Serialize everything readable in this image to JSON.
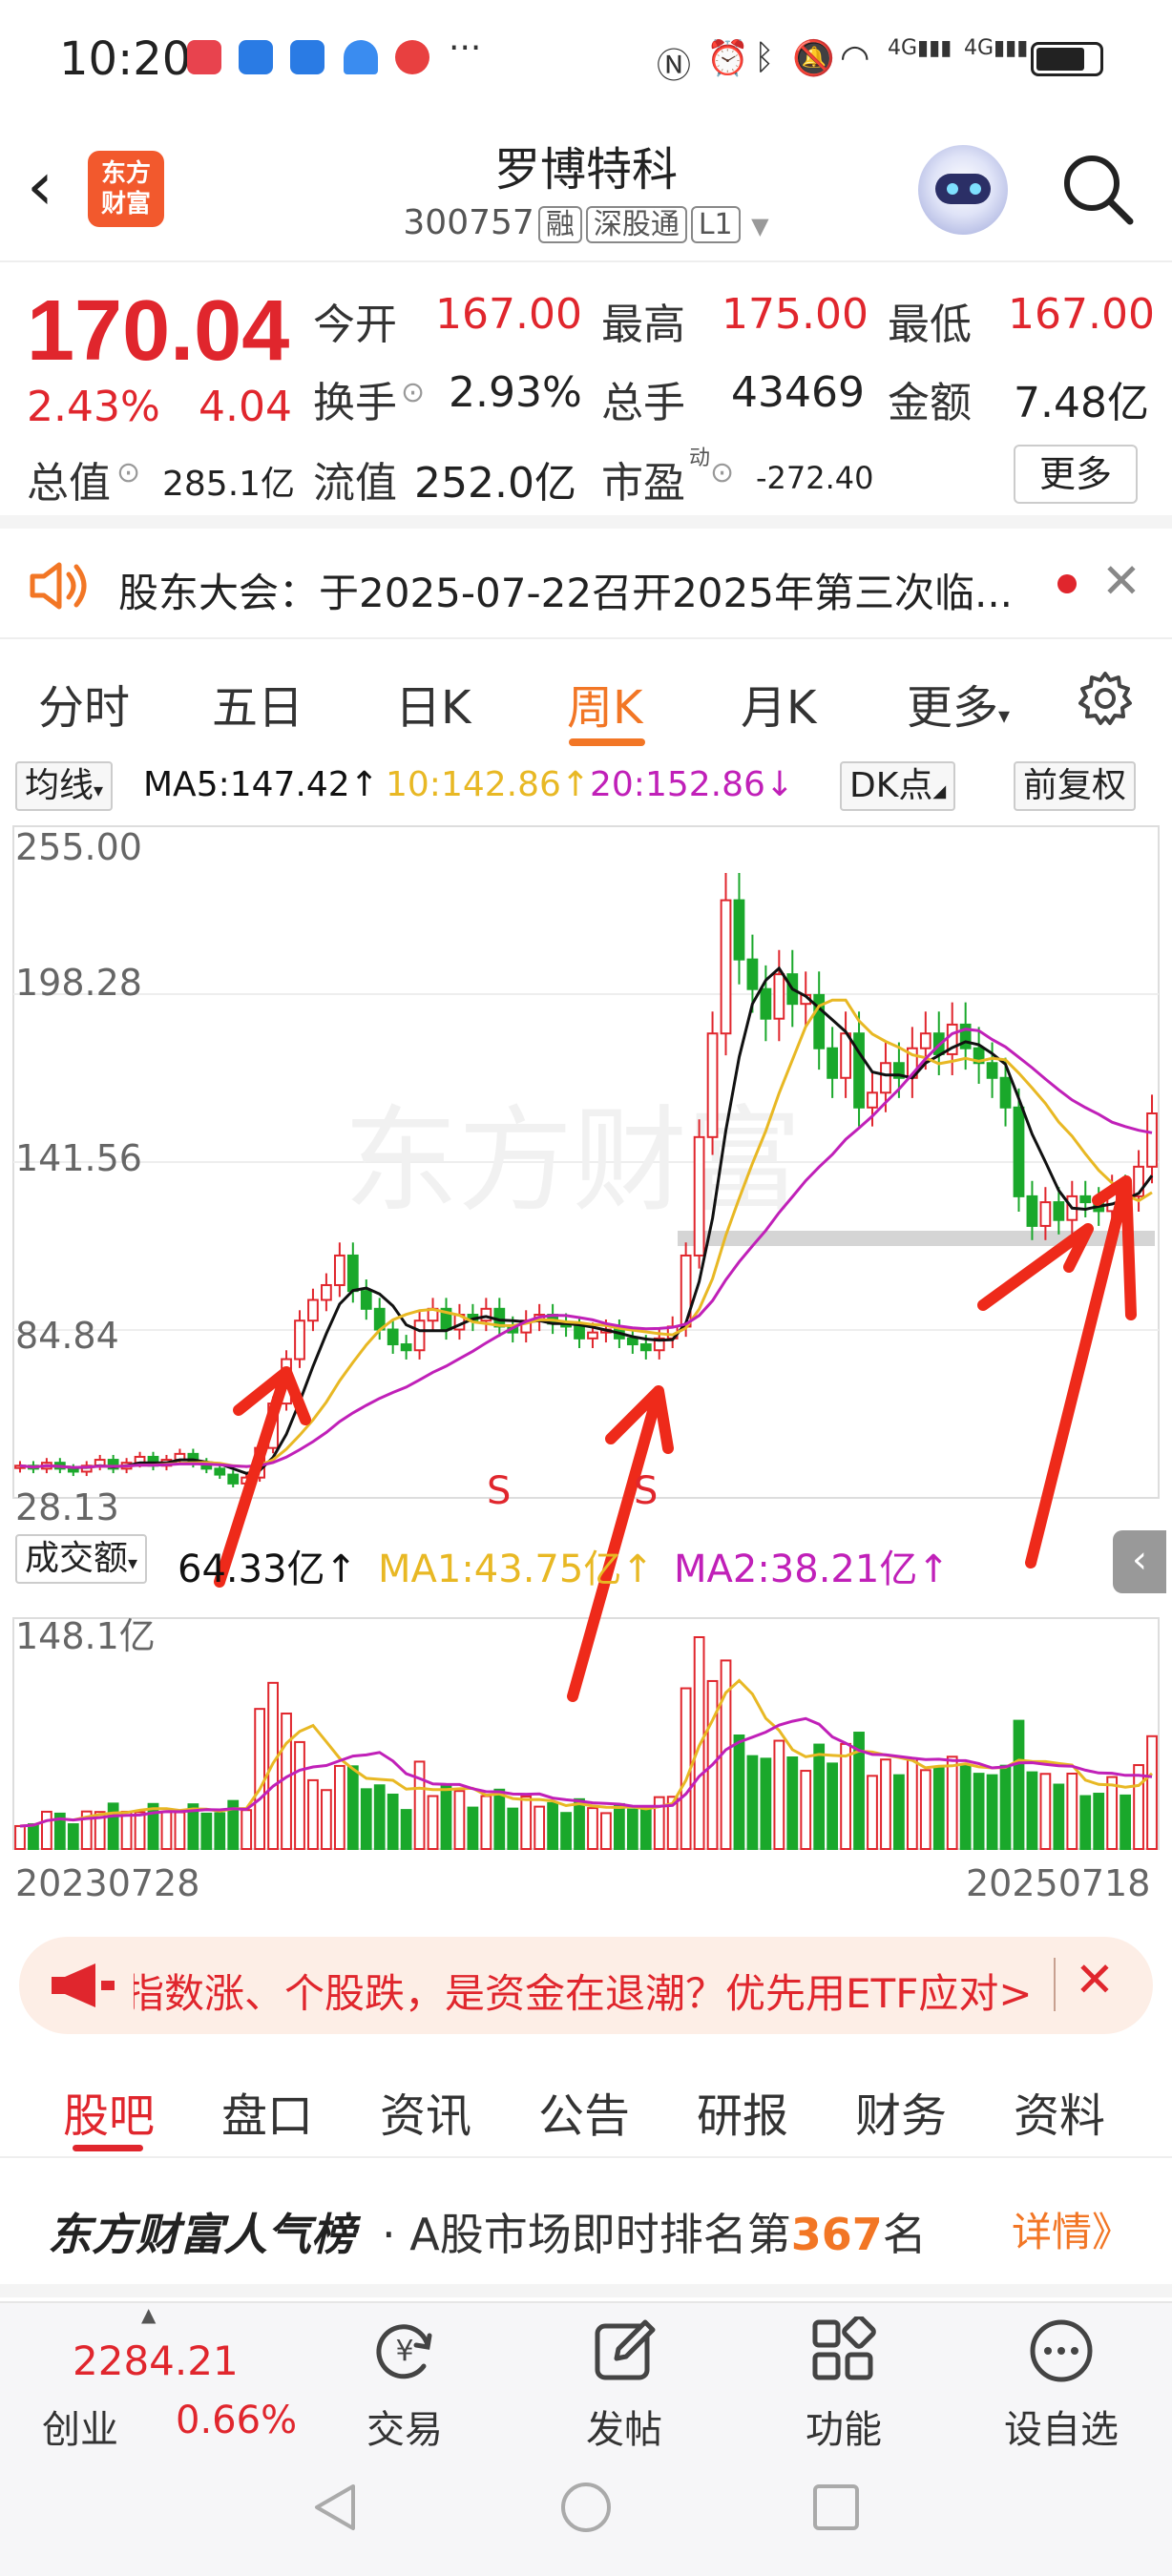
{
  "status_bar": {
    "time": "10:20",
    "network1": "4G",
    "network2": "4G"
  },
  "header": {
    "title": "罗博特科",
    "code": "300757",
    "tag1": "融",
    "tag2": "深股通",
    "tag3": "L1",
    "logo_text": "东方财富"
  },
  "quote": {
    "price": "170.04",
    "change_pct": "2.43%",
    "change": "4.04",
    "open_label": "今开",
    "open": "167.00",
    "high_label": "最高",
    "high": "175.00",
    "low_label": "最低",
    "low": "167.00",
    "turnover_label": "换手",
    "turnover": "2.93%",
    "volume_label": "总手",
    "volume": "43469",
    "amount_label": "金额",
    "amount": "7.48亿",
    "mcap_label": "总值",
    "mcap": "285.1亿",
    "float_label": "流值",
    "float_value": "252.0亿",
    "pe_label": "市盈",
    "pe_sup": "动",
    "pe": "-272.40",
    "more": "更多"
  },
  "notice": {
    "text": "股东大会：于2025-07-22召开2025年第三次临..."
  },
  "chart_tabs": [
    "分时",
    "五日",
    "日K",
    "周K",
    "月K",
    "更多"
  ],
  "indicators": {
    "ma_button": "均线",
    "ma5": "MA5:147.42↑",
    "ma10": "10:142.86↑",
    "ma20": "20:152.86↓",
    "dk_button": "DK点",
    "adjust_button": "前复权",
    "vol_button": "成交额",
    "vol_value": "64.33亿↑",
    "vol_ma1": "MA1:43.75亿↑",
    "vol_ma2": "MA2:38.21亿↑",
    "vol_max": "148.1亿",
    "date_start": "20230728",
    "date_end": "20250718",
    "annotation_s": "S"
  },
  "colors": {
    "up": "#e0262d",
    "down": "#1aa82b",
    "ma5": "#111111",
    "ma10": "#e8b824",
    "ma20": "#c020b8",
    "accent": "#f27625"
  },
  "chart_data": {
    "type": "candlestick",
    "y_ticks": [
      "255.00",
      "198.28",
      "141.56",
      "84.84",
      "28.13"
    ],
    "ylim": [
      28.13,
      255.0
    ],
    "x_range": [
      "20230728",
      "20250718"
    ],
    "closes": [
      39,
      38,
      40,
      38,
      37,
      39,
      41,
      38,
      40,
      42,
      39,
      41,
      43,
      40,
      38,
      36,
      33,
      35,
      45,
      60,
      75,
      88,
      95,
      100,
      110,
      98,
      92,
      85,
      80,
      78,
      88,
      92,
      85,
      90,
      88,
      92,
      86,
      84,
      88,
      90,
      87,
      86,
      82,
      84,
      85,
      82,
      80,
      78,
      82,
      86,
      110,
      150,
      185,
      230,
      210,
      200,
      190,
      205,
      195,
      198,
      180,
      170,
      185,
      160,
      165,
      175,
      170,
      180,
      185,
      178,
      188,
      180,
      175,
      170,
      160,
      130,
      120,
      128,
      122,
      130,
      128,
      125,
      132,
      130,
      140,
      158
    ],
    "volume_ylabel": "148.1亿"
  },
  "banner": {
    "text": "指数涨、个股跌，是资金在退潮？优先用ETF应对>"
  },
  "section_tabs": [
    "股吧",
    "盘口",
    "资讯",
    "公告",
    "研报",
    "财务",
    "资料"
  ],
  "rank": {
    "brand": "东方财富人气榜",
    "prefix": "· A股市场即时排名第",
    "num": "367",
    "suffix": "名",
    "detail": "详情》"
  },
  "bottom": {
    "index_value": "2284.21",
    "index_name": "创业",
    "index_pct": "0.66%",
    "trade": "交易",
    "post": "发帖",
    "func": "功能",
    "watch": "设自选"
  }
}
